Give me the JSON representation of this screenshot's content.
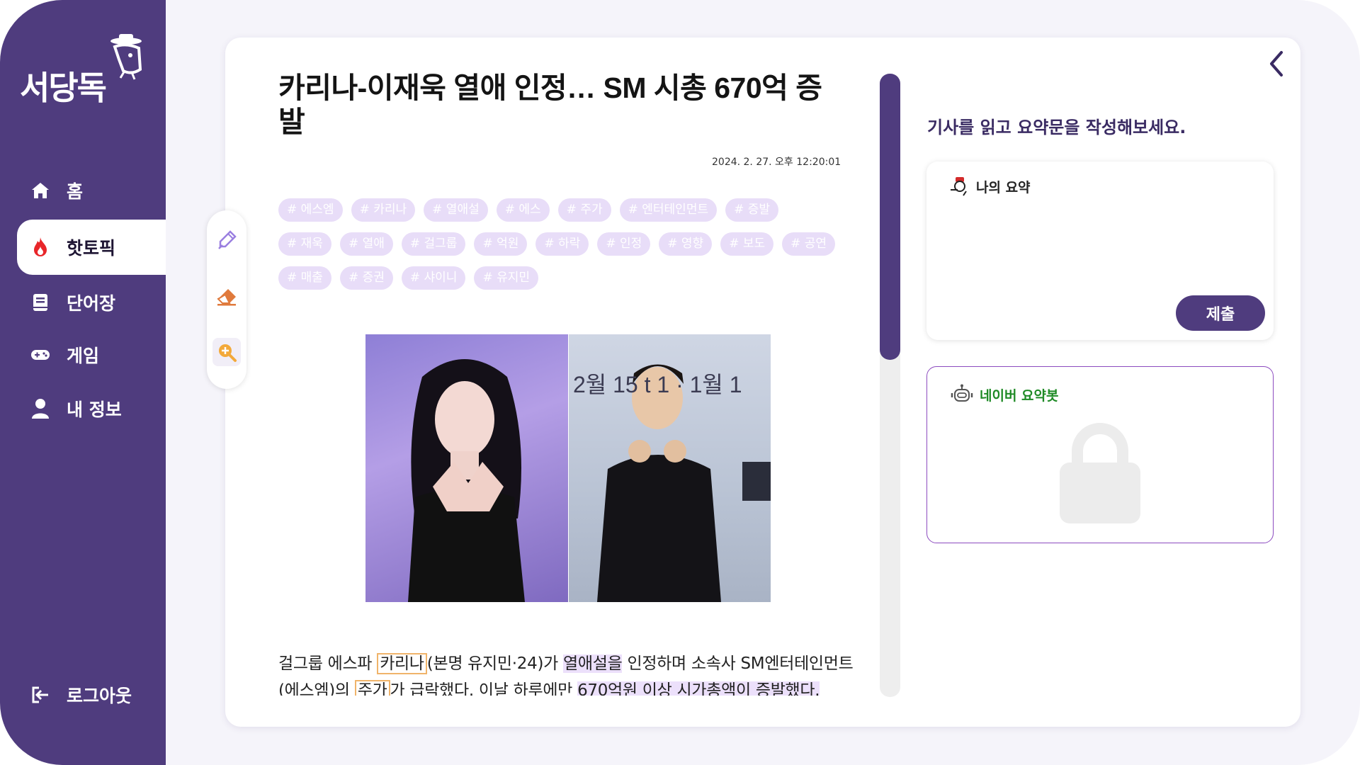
{
  "sidebar": {
    "logo_text": "서당독",
    "items": [
      {
        "label": "홈",
        "icon": "home-icon"
      },
      {
        "label": "핫토픽",
        "icon": "fire-icon",
        "active": true
      },
      {
        "label": "단어장",
        "icon": "book-icon"
      },
      {
        "label": "게임",
        "icon": "gamepad-icon"
      },
      {
        "label": "내 정보",
        "icon": "user-icon"
      }
    ],
    "logout_label": "로그아웃"
  },
  "article": {
    "title": "카리나-이재욱 열애 인정… SM 시총 670억 증발",
    "date": "2024. 2. 27. 오후 12:20:01",
    "tags_rows": [
      [
        "# 에스엠",
        "# 카리나",
        "# 열애설",
        "# 에스",
        "# 주가",
        "# 엔터테인먼트",
        "# 증발"
      ],
      [
        "# 재욱",
        "# 열애",
        "# 걸그룹",
        "# 억원",
        "# 하락",
        "# 인정",
        "# 영향",
        "# 보도",
        "# 공연"
      ],
      [
        "# 매출",
        "# 증권",
        "# 샤이니",
        "# 유지민"
      ]
    ],
    "photo_caption": "2월 15      t 1 · 1월 1",
    "body": {
      "p1": "걸그룹 에스파 ",
      "hl1": "카리나",
      "p2": "(본명 유지민·24)가 ",
      "hl2": "열애설을",
      "p3": " 인정하며 소속사 SM엔터테인먼트(에스엠)의 ",
      "hl3": "주가",
      "p4": "가 급락했다. 이날 하루에만 ",
      "hl4": "670억원 이상 시가총액이 증발했다."
    }
  },
  "tools": [
    {
      "name": "highlighter-pen-icon"
    },
    {
      "name": "eraser-icon"
    },
    {
      "name": "zoom-in-icon"
    }
  ],
  "summary": {
    "prompt": "기사를 읽고 요약문을 작성해보세요.",
    "my_summary_label": "나의 요약",
    "my_summary_value": "",
    "submit_label": "제출",
    "bot_label": "네이버 요약봇"
  },
  "colors": {
    "brand": "#4f3c7e",
    "tag_bg": "#e8ddf8",
    "highlight_box": "#f0b46a",
    "highlight_mark": "#ece0fb",
    "bot_green": "#1e8a25",
    "fire_red": "#e8262a"
  }
}
